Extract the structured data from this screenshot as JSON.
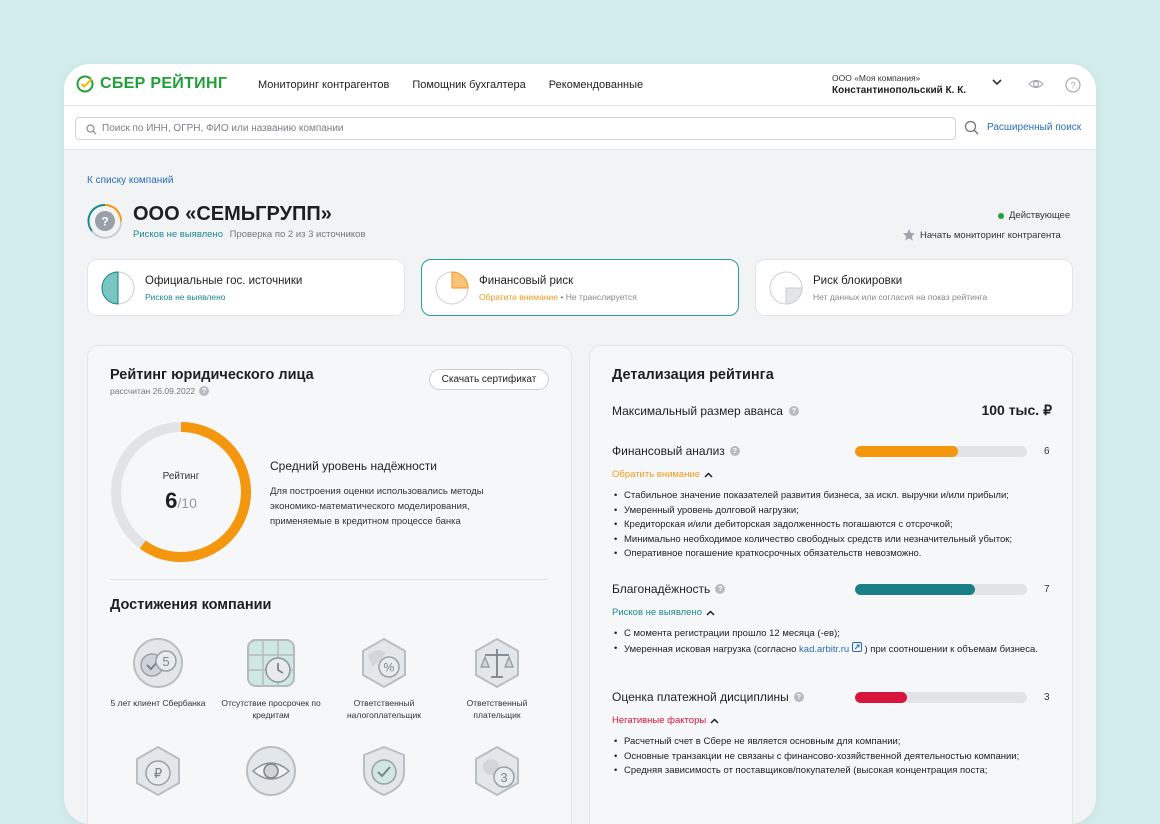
{
  "brand": {
    "name": "СБЕР РЕЙТИНГ",
    "color": "#21a038"
  },
  "nav": [
    "Мониторинг контрагентов",
    "Помощник бухгалтера",
    "Рекомендованные"
  ],
  "account": {
    "org": "ООО «Моя компания»",
    "user": "Константинопольский К. К."
  },
  "search": {
    "placeholder": "Поиск по ИНН, ОГРН, ФИО или названию компании",
    "advanced": "Расширенный поиск"
  },
  "breadcrumb": "К списку компаний",
  "company": {
    "name": "ООО «СЕМЬГРУПП»",
    "risk": "Рисков не выявлено",
    "check": "Проверка по 2 из 3 источников",
    "status": "Действующее",
    "monitor": "Начать мониторинг контрагента"
  },
  "sources": [
    {
      "title": "Официальные гос. источники",
      "status": "Рисков не выявлено",
      "status_color": "#1a8a8f",
      "extra": ""
    },
    {
      "title": "Финансовый риск",
      "status": "Обратите внимание",
      "status_color": "#f39a1a",
      "extra": "• Не транслируется"
    },
    {
      "title": "Риск блокировки",
      "status": "Нет данных или согласия на показ рейтинга",
      "status_color": "#888888",
      "extra": ""
    }
  ],
  "rating": {
    "title": "Рейтинг юридического лица",
    "date": "рассчитан 26.09.2022",
    "certificate": "Скачать сертификат",
    "label": "Рейтинг",
    "value": "6",
    "max": "/10",
    "score": 6,
    "score_max": 10,
    "level": "Средний уровень надёжности",
    "description": "Для построения оценки использовались методы экономико-математического моделирования, применяемые в кредитном процессе банка",
    "accent": "#f5960f"
  },
  "achievements": {
    "title": "Достижения компании",
    "items": [
      {
        "label": "5 лет клиент Сбербанка",
        "icon": "five-years-icon"
      },
      {
        "label": "Отсутствие просрочек по кредитам",
        "icon": "calendar-clock-icon"
      },
      {
        "label": "Ответственный налогоплательщик",
        "icon": "tax-percent-icon"
      },
      {
        "label": "Ответственный плательщик",
        "icon": "scales-icon"
      },
      {
        "label": "",
        "icon": "ruble-icon"
      },
      {
        "label": "",
        "icon": "eye-badge-icon"
      },
      {
        "label": "",
        "icon": "shield-check-icon"
      },
      {
        "label": "",
        "icon": "number-three-icon"
      }
    ]
  },
  "details": {
    "title": "Детализация рейтинга",
    "advance_label": "Максимальный размер аванса",
    "advance_value": "100 тыс. ₽",
    "sections": [
      {
        "label": "Финансовый анализ",
        "score": 6,
        "score_text": "6",
        "bar_fraction": 0.6,
        "color": "#f5960f",
        "status": "Обратить внимание",
        "status_color": "#f39a1a",
        "items": [
          "Стабильное значение показателей развития бизнеса, за искл. выручки и/или прибыли;",
          "Умеренный уровень долговой нагрузки;",
          "Кредиторская и/или дебиторская задолженность погашаются с отсрочкой;",
          "Минимально необходимое количество свободных средств или незначительный убыток;",
          "Оперативное погашение краткосрочных обязательств невозможно."
        ]
      },
      {
        "label": "Благонадёжность",
        "score": 7,
        "score_text": "7",
        "bar_fraction": 0.7,
        "color": "#1a7f87",
        "status": "Рисков не выявлено",
        "status_color": "#1a8a8f",
        "items": [
          "С момента регистрации прошло 12 месяца (-ев);",
          "Умеренная исковая нагрузка (согласно"
        ],
        "link": "kad.arbitr.ru",
        "link_tail": ") при соотношении к объемам бизнеса."
      },
      {
        "label": "Оценка платежной дисциплины",
        "score": 3,
        "score_text": "3",
        "bar_fraction": 0.3,
        "color": "#d8153c",
        "status": "Негативные факторы",
        "status_color": "#d8153c",
        "items": [
          "Расчетный счет в Сбере не является основным для компании;",
          "Основные транзакции не связаны с финансово-хозяйственной деятельностью компании;",
          "Средняя зависимость от поставщиков/покупателей (высокая концентрация поста;"
        ]
      }
    ]
  }
}
